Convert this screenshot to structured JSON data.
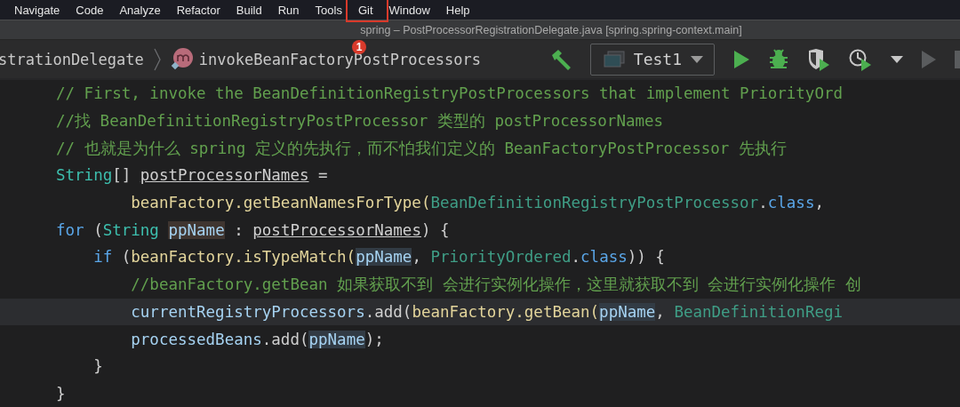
{
  "menu": [
    {
      "label": "Navigate"
    },
    {
      "label": "Code"
    },
    {
      "label": "Analyze"
    },
    {
      "label": "Refactor"
    },
    {
      "label": "Build"
    },
    {
      "label": "Run"
    },
    {
      "label": "Tools"
    },
    {
      "label": "Git"
    },
    {
      "label": "Window"
    },
    {
      "label": "Help"
    }
  ],
  "window": {
    "title": "spring – PostProcessorRegistrationDelegate.java [spring.spring-context.main]"
  },
  "annotation": {
    "badge": "1"
  },
  "breadcrumb": {
    "class_name": "strationDelegate",
    "method_name": "invokeBeanFactoryPostProcessors"
  },
  "run_config": {
    "label": "Test1"
  },
  "code": [
    {
      "current": false,
      "tokens": [
        {
          "text": "// First, invoke the BeanDefinitionRegistryPostProcessors that implement PriorityOrd",
          "kind": "comment"
        }
      ]
    },
    {
      "current": false,
      "tokens": [
        {
          "text": "//找 BeanDefinitionRegistryPostProcessor 类型的 postProcessorNames",
          "kind": "comment"
        }
      ]
    },
    {
      "current": false,
      "tokens": [
        {
          "text": "// 也就是为什么 spring 定义的先执行，而不怕我们定义的 BeanFactoryPostProcessor 先执行",
          "kind": "comment"
        }
      ]
    },
    {
      "current": false,
      "tokens": [
        {
          "text": "String",
          "kind": "type"
        },
        {
          "text": "[] ",
          "kind": "plain"
        },
        {
          "text": "postProcessorNames",
          "kind": "local"
        },
        {
          "text": " =",
          "kind": "plain"
        }
      ]
    },
    {
      "current": false,
      "tokens": [
        {
          "text": "        beanFactory.getBeanNamesForType(",
          "kind": "method"
        },
        {
          "text": "BeanDefinitionRegistryPostProcessor",
          "kind": "class"
        },
        {
          "text": ".",
          "kind": "plain"
        },
        {
          "text": "class",
          "kind": "keyword"
        },
        {
          "text": ", ",
          "kind": "plain"
        }
      ]
    },
    {
      "current": false,
      "tokens": [
        {
          "text": "for",
          "kind": "keyword"
        },
        {
          "text": " (",
          "kind": "plain"
        },
        {
          "text": "String ",
          "kind": "type"
        },
        {
          "text": "ppName",
          "kind": "var-write"
        },
        {
          "text": " : ",
          "kind": "plain"
        },
        {
          "text": "postProcessorNames",
          "kind": "local"
        },
        {
          "text": ") {",
          "kind": "plain"
        }
      ]
    },
    {
      "current": false,
      "tokens": [
        {
          "text": "    if",
          "kind": "keyword"
        },
        {
          "text": " (",
          "kind": "plain"
        },
        {
          "text": "beanFactory.isTypeMatch(",
          "kind": "method"
        },
        {
          "text": "ppName",
          "kind": "var-read"
        },
        {
          "text": ", ",
          "kind": "plain"
        },
        {
          "text": "PriorityOrdered",
          "kind": "class"
        },
        {
          "text": ".",
          "kind": "plain"
        },
        {
          "text": "class",
          "kind": "keyword"
        },
        {
          "text": ")) {",
          "kind": "plain"
        }
      ]
    },
    {
      "current": false,
      "tokens": [
        {
          "text": "        //beanFactory.getBean 如果获取不到 会进行实例化操作，这里就获取不到 会进行实例化操作 创",
          "kind": "comment"
        }
      ]
    },
    {
      "current": true,
      "tokens": [
        {
          "text": "        currentRegistryProcessors",
          "kind": "field"
        },
        {
          "text": ".add(",
          "kind": "plain"
        },
        {
          "text": "beanFactory.getBean(",
          "kind": "method"
        },
        {
          "text": "ppName",
          "kind": "var-read"
        },
        {
          "text": ", ",
          "kind": "plain"
        },
        {
          "text": "BeanDefinitionRegi",
          "kind": "class"
        }
      ]
    },
    {
      "current": false,
      "tokens": [
        {
          "text": "        processedBeans",
          "kind": "field"
        },
        {
          "text": ".add(",
          "kind": "plain"
        },
        {
          "text": "ppName",
          "kind": "var-read"
        },
        {
          "text": ");",
          "kind": "plain"
        }
      ]
    },
    {
      "current": false,
      "tokens": [
        {
          "text": "    }",
          "kind": "plain"
        }
      ]
    },
    {
      "current": false,
      "tokens": [
        {
          "text": "}",
          "kind": "plain"
        }
      ]
    }
  ]
}
